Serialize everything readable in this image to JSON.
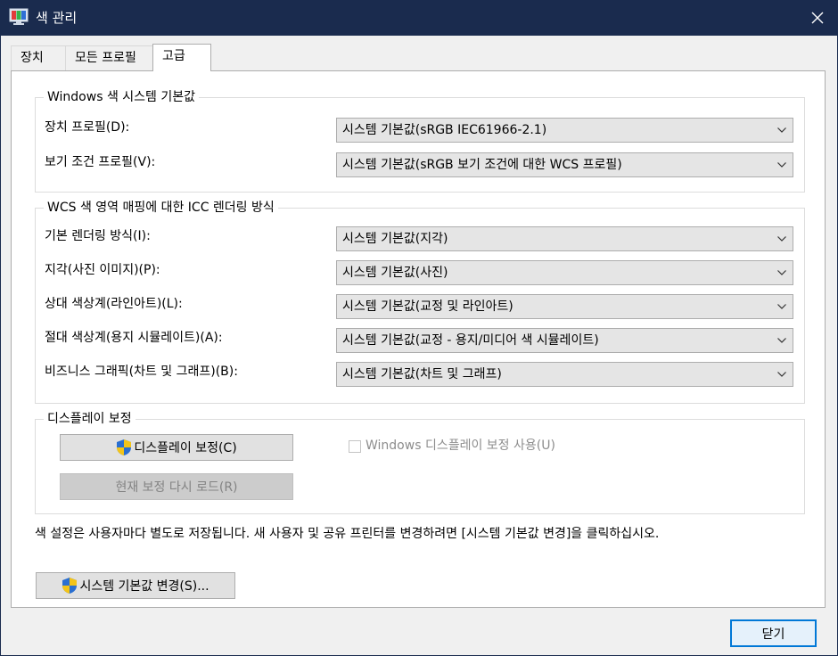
{
  "window": {
    "title": "색 관리",
    "close_glyph": "✕",
    "app_icon": "color-management-monitor-icon"
  },
  "tabs": [
    {
      "label": "장치",
      "active": false
    },
    {
      "label": "모든 프로필",
      "active": false
    },
    {
      "label": "고급",
      "active": true
    }
  ],
  "windows_defaults": {
    "legend": "Windows 색 시스템 기본값",
    "rows": [
      {
        "label": "장치 프로필(D):",
        "value": "시스템 기본값(sRGB IEC61966-2.1)"
      },
      {
        "label": "보기 조건 프로필(V):",
        "value": "시스템 기본값(sRGB 보기 조건에 대한 WCS 프로필)"
      }
    ]
  },
  "icc_rendering": {
    "legend": "WCS 색 영역 매핑에 대한 ICC 렌더링 방식",
    "rows": [
      {
        "label": "기본 렌더링 방식(I):",
        "value": "시스템 기본값(지각)"
      },
      {
        "label": "지각(사진 이미지)(P):",
        "value": "시스템 기본값(사진)"
      },
      {
        "label": "상대 색상계(라인아트)(L):",
        "value": "시스템 기본값(교정 및 라인아트)"
      },
      {
        "label": "절대 색상계(용지 시뮬레이트)(A):",
        "value": "시스템 기본값(교정 - 용지/미디어 색 시뮬레이트)"
      },
      {
        "label": "비즈니스 그래픽(차트 및 그래프)(B):",
        "value": "시스템 기본값(차트 및 그래프)"
      }
    ]
  },
  "display_calibration": {
    "legend": "디스플레이 보정",
    "calibrate_button": "디스플레이 보정(C)",
    "reload_button": "현재 보정 다시 로드(R)",
    "use_calibration_label": "Windows 디스플레이 보정 사용(U)",
    "use_calibration_checked": false
  },
  "note": "색 설정은 사용자마다 별도로 저장됩니다. 새 사용자 및 공유 프린터를 변경하려면 [시스템 기본값 변경]을 클릭하십시오.",
  "change_defaults_button": "시스템 기본값 변경(S)...",
  "close_button": "닫기",
  "colors": {
    "titlebar": "#1a2b4e",
    "focus_border": "#0078d7",
    "shield_blue": "#2a6fd1",
    "shield_yellow": "#f3c419"
  }
}
